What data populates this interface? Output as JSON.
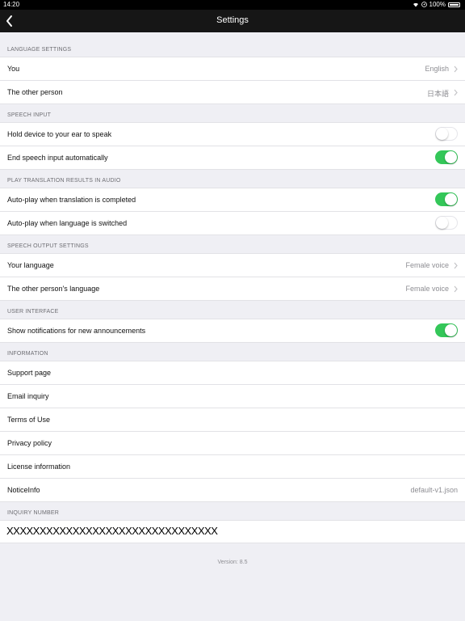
{
  "status": {
    "time": "14:20",
    "battery": "100%"
  },
  "nav": {
    "title": "Settings"
  },
  "sections": {
    "language": {
      "header": "LANGUAGE SETTINGS",
      "you_label": "You",
      "you_value": "English",
      "other_label": "The other person",
      "other_value": "日本語"
    },
    "speech_input": {
      "header": "SPEECH INPUT",
      "hold_label": "Hold device to your ear to speak",
      "hold_on": false,
      "end_label": "End speech input automatically",
      "end_on": true
    },
    "play": {
      "header": "PLAY TRANSLATION RESULTS IN AUDIO",
      "auto_complete_label": "Auto-play when translation is completed",
      "auto_complete_on": true,
      "auto_switch_label": "Auto-play when language is switched",
      "auto_switch_on": false
    },
    "speech_output": {
      "header": "SPEECH OUTPUT SETTINGS",
      "your_label": "Your language",
      "your_value": "Female voice",
      "other_label": "The other person's language",
      "other_value": "Female voice"
    },
    "ui": {
      "header": "USER INTERFACE",
      "notif_label": "Show notifications for new announcements",
      "notif_on": true
    },
    "info": {
      "header": "INFORMATION",
      "support": "Support page",
      "email": "Email inquiry",
      "terms": "Terms of Use",
      "privacy": "Privacy policy",
      "license": "License information",
      "notice_label": "NoticeInfo",
      "notice_value": "default-v1.json"
    },
    "inquiry": {
      "header": "INQUIRY NUMBER",
      "value": "XXXXXXXXXXXXXXXXXXXXXXXXXXXXXXXX"
    }
  },
  "version": "Version: 8.5",
  "colors": {
    "toggle_on": "#34c759",
    "navbar": "#161616",
    "background": "#efeff4"
  },
  "icons": [
    "wifi-icon",
    "location-icon",
    "battery-icon",
    "back-chevron-icon",
    "chevron-right-icon"
  ]
}
